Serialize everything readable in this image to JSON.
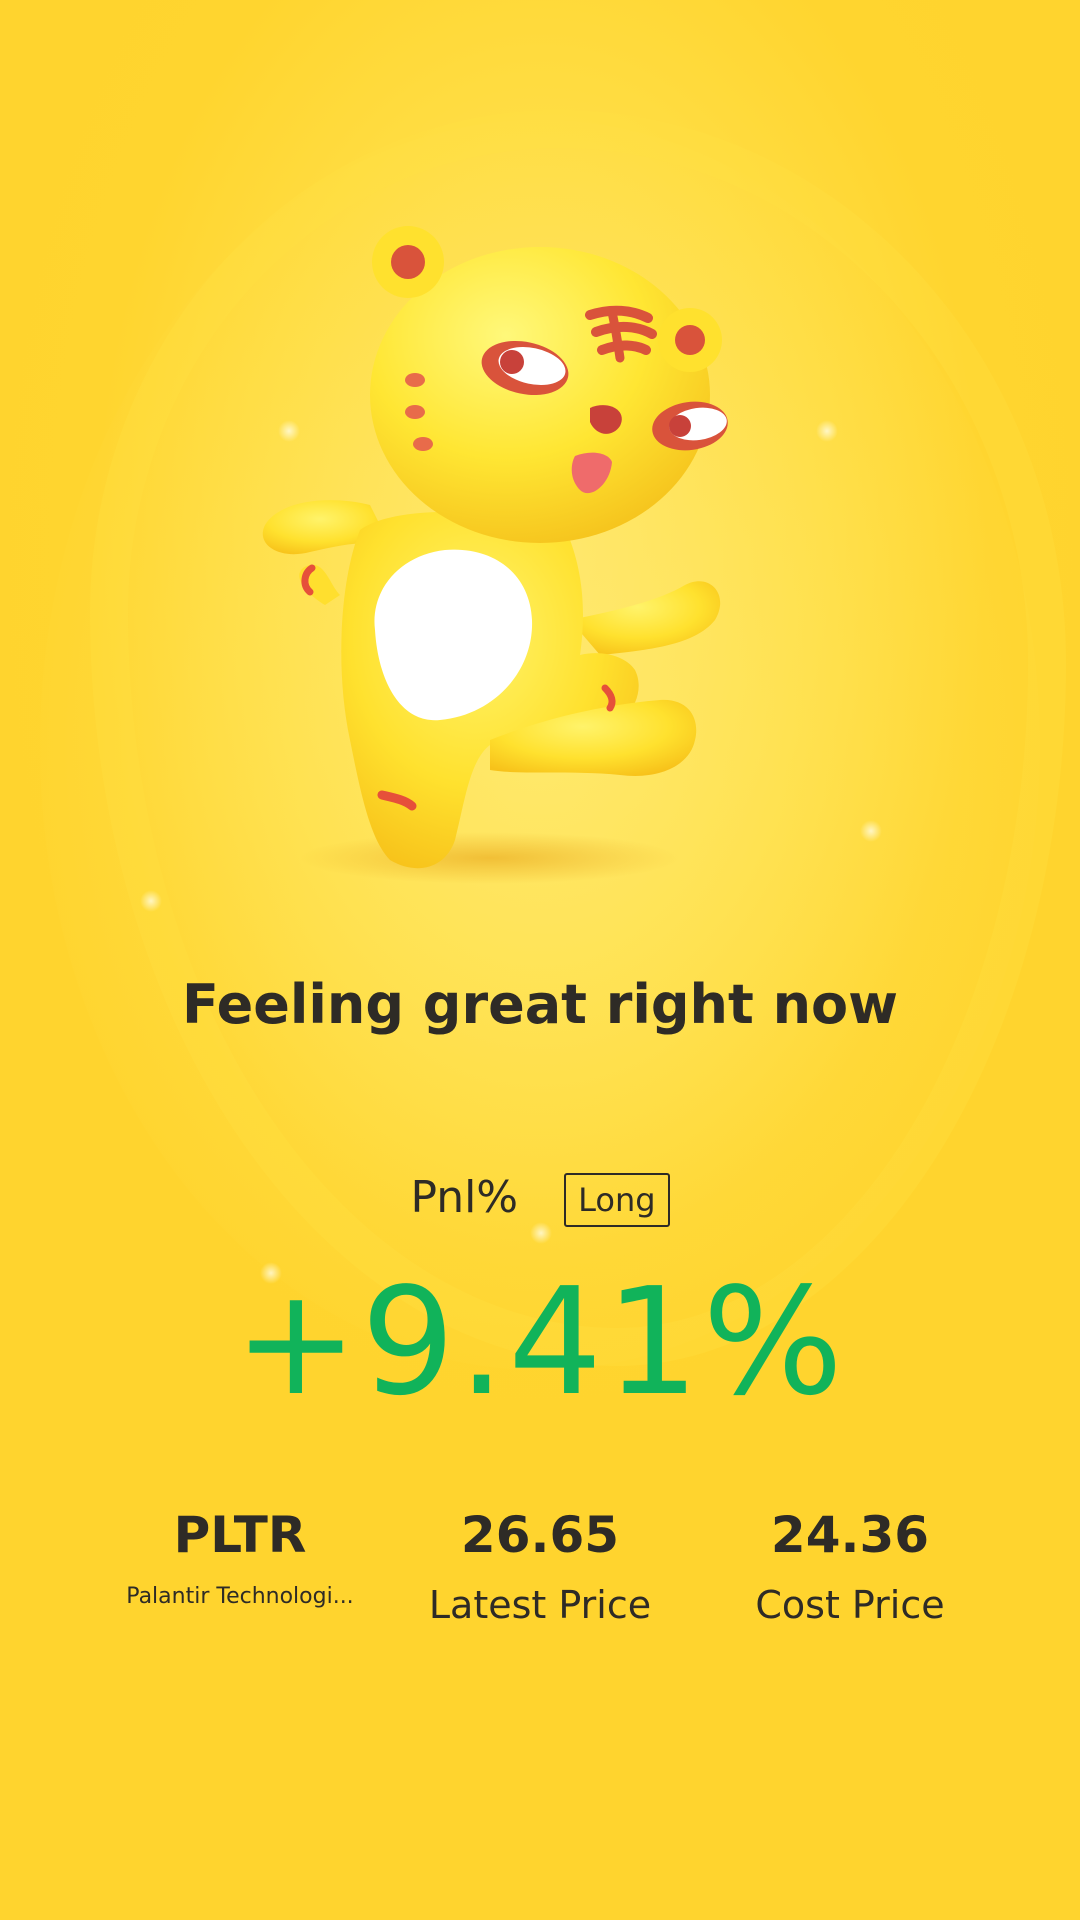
{
  "headline": "Feeling great right now",
  "pnl": {
    "label": "Pnl%",
    "position_tag": "Long",
    "value": "+9.41%",
    "value_color": "#11b35a"
  },
  "stats": {
    "symbol": "PLTR",
    "company_name": "Palantir Technologi...",
    "latest_price": "26.65",
    "latest_price_label": "Latest Price",
    "cost_price": "24.36",
    "cost_price_label": "Cost Price"
  },
  "mascot": {
    "icon": "tiger-mascot-icon"
  },
  "colors": {
    "background": "#ffd93a",
    "text": "#2e2b26",
    "positive": "#11b35a"
  }
}
